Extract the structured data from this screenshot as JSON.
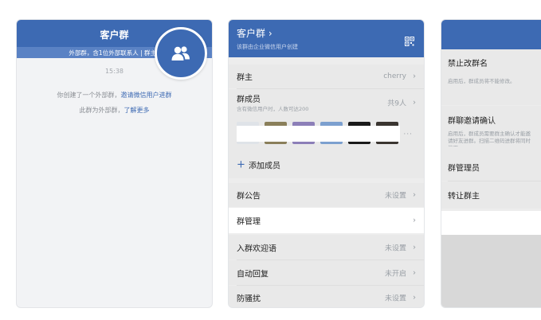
{
  "panel1": {
    "title": "客户群",
    "banner": "外部群，含1位外部联系人 | 群主",
    "time": "15:38",
    "msg1_prefix": "你创建了一个外部群，",
    "msg1_link": "邀请微信用户进群",
    "msg2_prefix": "此群为外部群，",
    "msg2_link": "了解更多",
    "fab_icon": "group-members-icon"
  },
  "panel2": {
    "title": "客户群 ›",
    "subtitle": "该群由企业微信用户创建",
    "owner_label": "群主",
    "owner_value": "cherry",
    "members_label": "群成员",
    "members_sub": "含有微信用户时，人数可达200",
    "members_value": "共9人",
    "add_plus": "+",
    "add_label": "添加成员",
    "announcement_label": "群公告",
    "announcement_value": "未设置",
    "manage_label": "群管理",
    "welcome_label": "入群欢迎语",
    "welcome_value": "未设置",
    "autoreply_label": "自动回复",
    "autoreply_value": "未开启",
    "antispam_label": "防骚扰",
    "antispam_value": "未设置",
    "chevron": "›",
    "more_dots": "···",
    "accent": "#3d6ab3"
  },
  "panel3": {
    "rename_title": "禁止改群名",
    "rename_desc": "启用后，群成员将不能修改。",
    "invite_title": "群聊邀请确认",
    "invite_desc": "启用后，群成员需要群主确认才能邀请好友进群。扫描二维码进群将同时停用。",
    "admins_title": "群管理员",
    "transfer_title": "转让群主"
  }
}
